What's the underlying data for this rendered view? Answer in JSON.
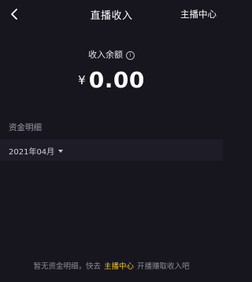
{
  "header": {
    "back_icon": "chevron-left-icon",
    "title": "直播收入",
    "right_link": "主播中心"
  },
  "balance": {
    "label": "收入余额",
    "info_icon": "info-icon",
    "currency": "¥",
    "amount": "0.00"
  },
  "details": {
    "section_label": "资金明细",
    "month": "2021年04月",
    "dropdown_icon": "caret-down-icon"
  },
  "empty_state": {
    "prefix": "暂无资金明细，快去",
    "link": "主播中心",
    "suffix": "开播赚取收入吧",
    "link_color": "#f2c432"
  }
}
